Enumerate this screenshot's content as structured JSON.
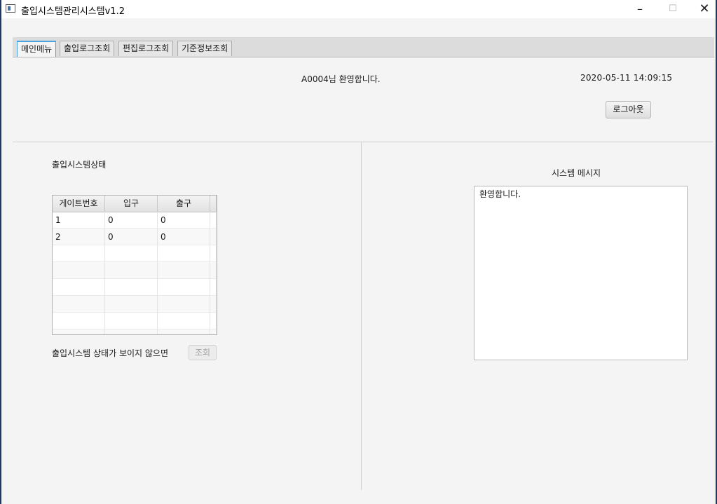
{
  "window": {
    "title": "출입시스템관리시스템v1.2",
    "min_glyph": "–",
    "max_glyph": "☐",
    "close_glyph": "✕"
  },
  "tabs": [
    {
      "label": "메인메뉴",
      "active": true
    },
    {
      "label": "출입로그조회",
      "active": false
    },
    {
      "label": "편집로그조회",
      "active": false
    },
    {
      "label": "기준정보조회",
      "active": false
    }
  ],
  "header": {
    "welcome": "A0004님 환영합니다.",
    "datetime": "2020-05-11 14:09:15",
    "logout_label": "로그아웃"
  },
  "status_panel": {
    "title": "출입시스템상태",
    "columns": [
      "게이트번호",
      "입구",
      "출구"
    ],
    "rows": [
      [
        "1",
        "0",
        "0"
      ],
      [
        "2",
        "0",
        "0"
      ]
    ],
    "hint": "출입시스템 상태가 보이지 않으면",
    "query_label": "조회"
  },
  "message_panel": {
    "title": "시스템 메시지",
    "text": "환영합니다."
  }
}
